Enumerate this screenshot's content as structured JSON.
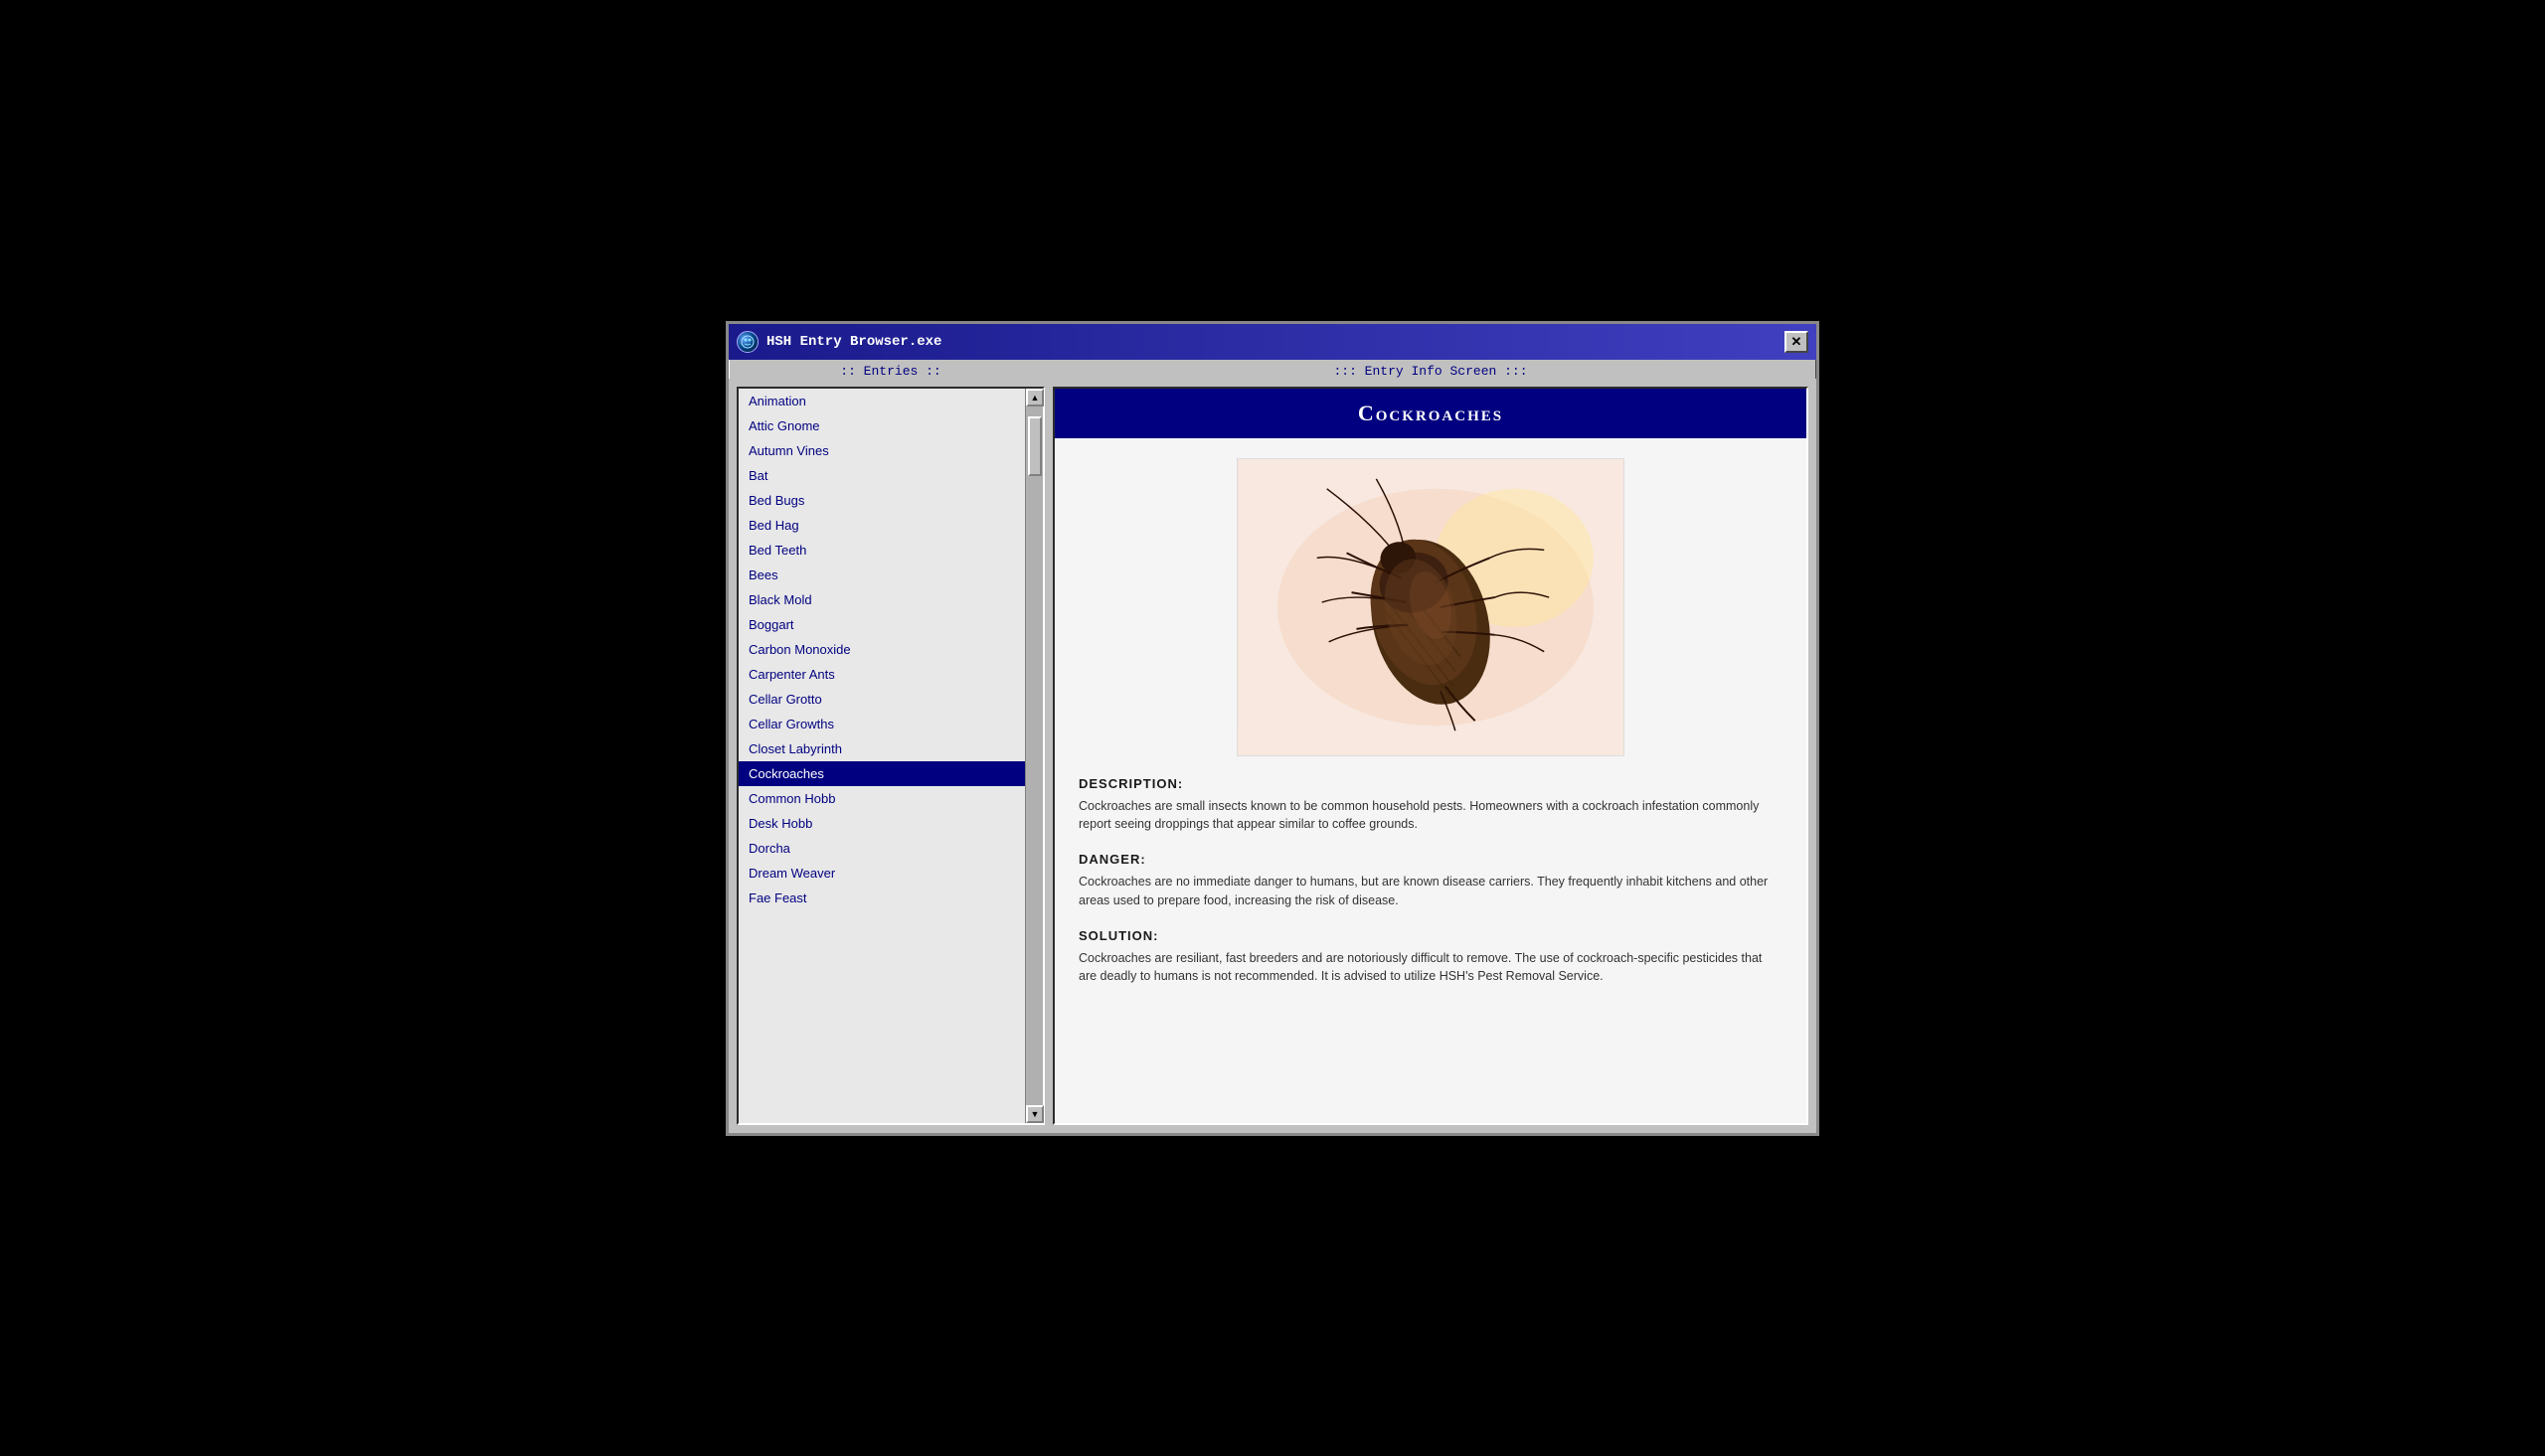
{
  "window": {
    "title": "HSH Entry Browser.exe",
    "close_label": "✕"
  },
  "panels": {
    "left_header": ":: Entries ::",
    "right_header": "::: Entry Info Screen :::"
  },
  "entries": [
    {
      "id": "animation",
      "label": "Animation",
      "selected": false
    },
    {
      "id": "attic-gnome",
      "label": "Attic Gnome",
      "selected": false
    },
    {
      "id": "autumn-vines",
      "label": "Autumn Vines",
      "selected": false
    },
    {
      "id": "bat",
      "label": "Bat",
      "selected": false
    },
    {
      "id": "bed-bugs",
      "label": "Bed Bugs",
      "selected": false
    },
    {
      "id": "bed-hag",
      "label": "Bed Hag",
      "selected": false
    },
    {
      "id": "bed-teeth",
      "label": "Bed Teeth",
      "selected": false
    },
    {
      "id": "bees",
      "label": "Bees",
      "selected": false
    },
    {
      "id": "black-mold",
      "label": "Black Mold",
      "selected": false
    },
    {
      "id": "boggart",
      "label": "Boggart",
      "selected": false
    },
    {
      "id": "carbon-monoxide",
      "label": "Carbon Monoxide",
      "selected": false
    },
    {
      "id": "carpenter-ants",
      "label": "Carpenter Ants",
      "selected": false
    },
    {
      "id": "cellar-grotto",
      "label": "Cellar Grotto",
      "selected": false
    },
    {
      "id": "cellar-growths",
      "label": "Cellar Growths",
      "selected": false
    },
    {
      "id": "closet-labyrinth",
      "label": "Closet Labyrinth",
      "selected": false
    },
    {
      "id": "cockroaches",
      "label": "Cockroaches",
      "selected": true
    },
    {
      "id": "common-hobb",
      "label": "Common Hobb",
      "selected": false
    },
    {
      "id": "desk-hobb",
      "label": "Desk Hobb",
      "selected": false
    },
    {
      "id": "dorcha",
      "label": "Dorcha",
      "selected": false
    },
    {
      "id": "dream-weaver",
      "label": "Dream Weaver",
      "selected": false
    },
    {
      "id": "fae-feast",
      "label": "Fae Feast",
      "selected": false
    }
  ],
  "entry": {
    "title": "Cockroaches",
    "description_label": "DESCRIPTION:",
    "description_text": "Cockroaches are small insects known to be common household pests. Homeowners with a cockroach infestation commonly report seeing droppings that appear similar to coffee grounds.",
    "danger_label": "DANGER:",
    "danger_text": "Cockroaches are no immediate danger to humans, but are known disease carriers. They frequently inhabit kitchens and other areas used to prepare food, increasing the risk of disease.",
    "solution_label": "SOLUTION:",
    "solution_text": "Cockroaches are resiliant, fast breeders and are notoriously difficult to remove. The use of cockroach-specific pesticides that are deadly to humans is not recommended. It is advised to utilize HSH's Pest Removal Service."
  }
}
